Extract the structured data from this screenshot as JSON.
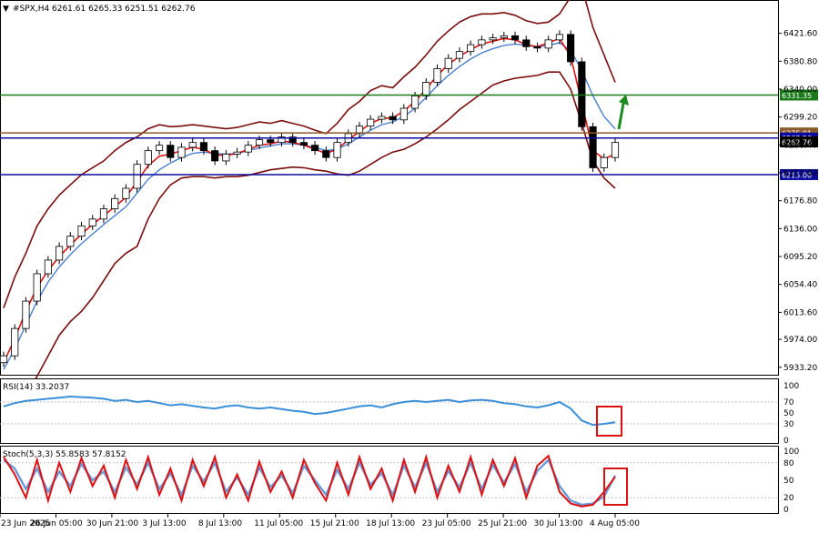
{
  "header": {
    "symbol": "#SPX,H4",
    "ohlc": "6261.61 6265.33 6251.51 6262.76"
  },
  "colors": {
    "candle_up": "#000000",
    "candle_down": "#000000",
    "fast_ma": "#dd1111",
    "mid_ma": "#4a7fd0",
    "bollinger": "#7a0d0d",
    "resistance_green": "#1a7a1a",
    "support_blue": "#0a0a9e",
    "level_brown": "#8b5a2b",
    "rsi_line": "#3a8fd8",
    "stoch_main": "#dd1111",
    "stoch_signal": "#6a9ad8",
    "highlight_box": "#dd1111",
    "arrow_green": "#1a8a1a"
  },
  "chart_data": [
    {
      "type": "line",
      "title": "#SPX,H4",
      "subtitle": "6261.61 6265.33 6251.51 6262.76",
      "series": [
        {
          "name": "",
          "role": "close",
          "values": [
            5950,
            5990,
            6030,
            6070,
            6090,
            6110,
            6125,
            6140,
            6150,
            6165,
            6180,
            6195,
            6230,
            6250,
            6258,
            6240,
            6255,
            6262,
            6250,
            6235,
            6245,
            6248,
            6258,
            6266,
            6262,
            6270,
            6262,
            6258,
            6250,
            6240,
            6262,
            6275,
            6286,
            6296,
            6300,
            6295,
            6312,
            6330,
            6350,
            6370,
            6385,
            6395,
            6405,
            6412,
            6415,
            6418,
            6412,
            6402,
            6400,
            6412,
            6420,
            6380,
            6285,
            6225,
            6240,
            6262
          ]
        },
        {
          "name": "",
          "role": "fast MA",
          "values": [
            5940,
            5975,
            6015,
            6050,
            6075,
            6095,
            6112,
            6128,
            6142,
            6155,
            6168,
            6182,
            6205,
            6228,
            6242,
            6245,
            6250,
            6255,
            6252,
            6244,
            6243,
            6246,
            6252,
            6258,
            6260,
            6264,
            6262,
            6258,
            6252,
            6246,
            6252,
            6266,
            6278,
            6290,
            6297,
            6298,
            6308,
            6322,
            6340,
            6360,
            6376,
            6388,
            6398,
            6406,
            6410,
            6414,
            6412,
            6405,
            6402,
            6408,
            6414,
            6388,
            6320,
            6250,
            6238,
            6245
          ]
        },
        {
          "name": "",
          "role": "middle MA",
          "values": [
            5930,
            5960,
            5995,
            6030,
            6058,
            6080,
            6098,
            6114,
            6128,
            6142,
            6155,
            6168,
            6188,
            6208,
            6222,
            6232,
            6240,
            6246,
            6248,
            6246,
            6245,
            6246,
            6250,
            6254,
            6257,
            6260,
            6260,
            6258,
            6255,
            6250,
            6252,
            6260,
            6270,
            6280,
            6288,
            6292,
            6300,
            6312,
            6328,
            6345,
            6360,
            6373,
            6384,
            6393,
            6399,
            6404,
            6406,
            6404,
            6402,
            6404,
            6408,
            6396,
            6368,
            6330,
            6300,
            6282
          ]
        },
        {
          "name": "",
          "role": "upper band",
          "values": [
            6020,
            6065,
            6100,
            6140,
            6165,
            6185,
            6200,
            6215,
            6225,
            6235,
            6250,
            6262,
            6270,
            6282,
            6288,
            6285,
            6286,
            6288,
            6286,
            6284,
            6282,
            6284,
            6288,
            6292,
            6290,
            6294,
            6290,
            6286,
            6280,
            6275,
            6290,
            6310,
            6322,
            6338,
            6345,
            6342,
            6358,
            6372,
            6390,
            6410,
            6425,
            6438,
            6446,
            6450,
            6450,
            6452,
            6448,
            6440,
            6436,
            6438,
            6450,
            6475,
            6490,
            6430,
            6390,
            6350
          ]
        },
        {
          "name": "",
          "role": "lower band",
          "values": [
            5860,
            5860,
            5890,
            5920,
            5950,
            5980,
            6000,
            6015,
            6035,
            6060,
            6085,
            6100,
            6110,
            6150,
            6180,
            6200,
            6210,
            6212,
            6212,
            6210,
            6212,
            6212,
            6214,
            6218,
            6222,
            6224,
            6226,
            6225,
            6222,
            6220,
            6216,
            6214,
            6220,
            6230,
            6240,
            6248,
            6252,
            6260,
            6270,
            6282,
            6295,
            6310,
            6322,
            6334,
            6346,
            6352,
            6356,
            6358,
            6360,
            6365,
            6365,
            6340,
            6290,
            6235,
            6210,
            6195
          ]
        }
      ],
      "ylim": [
        5925,
        6465
      ],
      "yticks": [
        "6421.60",
        "6380.80",
        "6340.00",
        "6299.20",
        "6258.40",
        "6217.60",
        "6176.80",
        "6136.00",
        "6095.20",
        "6054.40",
        "6013.60",
        "5974.00",
        "5933.20"
      ],
      "x_ticks": [
        "23 Jun 2025",
        "26 Jun 05:00",
        "30 Jun 21:00",
        "3 Jul 13:00",
        "8 Jul 13:00",
        "11 Jul 05:00",
        "15 Jul 21:00",
        "18 Jul 13:00",
        "23 Jul 05:00",
        "25 Jul 21:00",
        "30 Jul 13:00",
        "4 Aug 05:00"
      ],
      "levels": [
        {
          "label": "6331.35",
          "value": 6331.35,
          "color": "#1a7a1a"
        },
        {
          "label": "6275.91",
          "value": 6275.91,
          "color": "#8b5a2b"
        },
        {
          "label": "6268.50",
          "value": 6268.5,
          "color": "#0a0a9e"
        },
        {
          "label": "6262.76",
          "value": 6262.76,
          "color": "#000000"
        },
        {
          "label": "6215.00",
          "value": 6215.0,
          "color": "#0a0a9e"
        }
      ],
      "grid": false
    },
    {
      "type": "line",
      "title": "RSI(14) 33.2037",
      "series": [
        {
          "name": "",
          "values": [
            62,
            68,
            72,
            74,
            76,
            78,
            80,
            79,
            78,
            76,
            72,
            74,
            70,
            72,
            68,
            64,
            66,
            63,
            60,
            58,
            62,
            64,
            60,
            58,
            60,
            57,
            54,
            52,
            48,
            50,
            54,
            58,
            62,
            64,
            60,
            66,
            70,
            72,
            70,
            72,
            74,
            70,
            73,
            74,
            72,
            68,
            66,
            62,
            60,
            64,
            70,
            58,
            36,
            28,
            30,
            33
          ]
        }
      ],
      "ylim": [
        0,
        100
      ],
      "yticks": [
        "100",
        "70",
        "50",
        "30",
        "0"
      ]
    },
    {
      "type": "line",
      "title": "Stoch(5,3,3) 55.8583 57.8152",
      "series": [
        {
          "name": "",
          "role": "main",
          "values": [
            90,
            60,
            20,
            85,
            15,
            80,
            30,
            88,
            40,
            75,
            20,
            85,
            35,
            90,
            25,
            70,
            15,
            85,
            40,
            90,
            20,
            60,
            15,
            82,
            30,
            65,
            20,
            85,
            45,
            15,
            80,
            25,
            90,
            35,
            70,
            15,
            85,
            30,
            90,
            20,
            75,
            30,
            90,
            25,
            85,
            40,
            88,
            20,
            75,
            92,
            30,
            10,
            5,
            8,
            30,
            56
          ]
        },
        {
          "name": "",
          "role": "signal",
          "values": [
            85,
            70,
            35,
            70,
            30,
            65,
            40,
            78,
            50,
            65,
            30,
            72,
            42,
            80,
            35,
            62,
            25,
            75,
            48,
            80,
            30,
            55,
            25,
            72,
            38,
            58,
            28,
            75,
            50,
            25,
            68,
            35,
            80,
            42,
            62,
            25,
            75,
            38,
            80,
            30,
            66,
            38,
            80,
            35,
            76,
            46,
            78,
            30,
            66,
            85,
            40,
            15,
            8,
            10,
            22,
            58
          ]
        }
      ],
      "ylim": [
        0,
        100
      ],
      "yticks": [
        "100",
        "80",
        "50",
        "20",
        "0"
      ]
    }
  ]
}
